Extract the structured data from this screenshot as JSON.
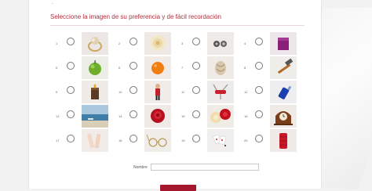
{
  "page": {
    "title": "Seleccione la imagen de su preferencia y de fácil recordación",
    "corner_mark": "-"
  },
  "options": [
    {
      "number": "1",
      "icon": "ring-icon"
    },
    {
      "number": "2",
      "icon": "white-flower-icon"
    },
    {
      "number": "3",
      "icon": "earrings-icon"
    },
    {
      "number": "4",
      "icon": "purple-box-icon"
    },
    {
      "number": "5",
      "icon": "green-apple-icon"
    },
    {
      "number": "6",
      "icon": "orange-icon"
    },
    {
      "number": "7",
      "icon": "seashell-icon"
    },
    {
      "number": "8",
      "icon": "hammer-icon"
    },
    {
      "number": "9",
      "icon": "candle-icon"
    },
    {
      "number": "10",
      "icon": "doll-icon"
    },
    {
      "number": "11",
      "icon": "swiss-knife-icon"
    },
    {
      "number": "12",
      "icon": "blue-bottle-icon"
    },
    {
      "number": "13",
      "icon": "beach-icon"
    },
    {
      "number": "14",
      "icon": "red-rose-icon"
    },
    {
      "number": "15",
      "icon": "roses-icon"
    },
    {
      "number": "16",
      "icon": "clock-icon"
    },
    {
      "number": "17",
      "icon": "tape-measure-icon"
    },
    {
      "number": "18",
      "icon": "glasses-icon"
    },
    {
      "number": "19",
      "icon": "playing-cards-icon"
    },
    {
      "number": "20",
      "icon": "red-cylinder-icon"
    }
  ],
  "form": {
    "name_label": "Nombre",
    "name_value": "",
    "submit_label": ""
  },
  "colors": {
    "accent": "#b0303c",
    "button": "#a4162c"
  }
}
